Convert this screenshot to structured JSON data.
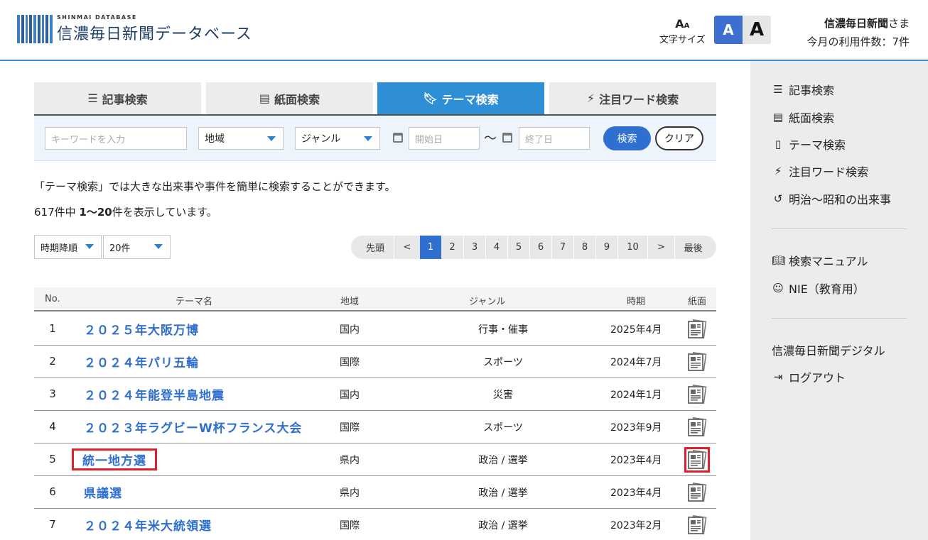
{
  "header": {
    "logo_sub": "SHINMAI DATABASE",
    "logo_title": "信濃毎日新聞データベース",
    "font_size_label": "文字サイズ",
    "font_size_icon": "font-size-icon",
    "font_small": "A",
    "font_large": "A",
    "user_name": "信濃毎日新聞",
    "user_suffix": "さま",
    "usage": "今月の利用件数：7件"
  },
  "tabs": [
    {
      "label": "記事検索",
      "icon": "list-icon"
    },
    {
      "label": "紙面検索",
      "icon": "newspaper-icon"
    },
    {
      "label": "テーマ検索",
      "icon": "bookmark-icon",
      "active": true
    },
    {
      "label": "注目ワード検索",
      "icon": "lightning-icon"
    }
  ],
  "search": {
    "keyword_placeholder": "キーワードを入力",
    "region_value": "地域",
    "genre_value": "ジャンル",
    "start_placeholder": "開始日",
    "tilde": "〜",
    "end_placeholder": "終了日",
    "search_label": "検索",
    "clear_label": "クリア"
  },
  "description": "「テーマ検索」では大きな出来事や事件を簡単に検索することができます。",
  "result": {
    "total": "617件中 ",
    "range": "1〜20",
    "suffix": "件を表示しています。"
  },
  "sort": {
    "order_value": "時期降順",
    "per_page_value": "20件"
  },
  "pager": {
    "first": "先頭",
    "prev": "<",
    "pages": [
      "1",
      "2",
      "3",
      "4",
      "5",
      "6",
      "7",
      "8",
      "9",
      "10"
    ],
    "current": "1",
    "next": ">",
    "last": "最後"
  },
  "table": {
    "headers": [
      "No.",
      "テーマ名",
      "地域",
      "ジャンル",
      "時期",
      "紙面"
    ],
    "rows": [
      {
        "no": "1",
        "name": "２０２５年大阪万博",
        "region": "国内",
        "genre": "行事・催事",
        "period": "2025年4月"
      },
      {
        "no": "2",
        "name": "２０２４年パリ五輪",
        "region": "国際",
        "genre": "スポーツ",
        "period": "2024年7月"
      },
      {
        "no": "3",
        "name": "２０２４年能登半島地震",
        "region": "国内",
        "genre": "災害",
        "period": "2024年1月"
      },
      {
        "no": "4",
        "name": "２０２３年ラグビーW杯フランス大会",
        "region": "国際",
        "genre": "スポーツ",
        "period": "2023年9月"
      },
      {
        "no": "5",
        "name": "統一地方選",
        "region": "県内",
        "genre": "政治 / 選挙",
        "period": "2023年4月",
        "highlighted": true
      },
      {
        "no": "6",
        "name": "県議選",
        "region": "県内",
        "genre": "政治 / 選挙",
        "period": "2023年4月"
      },
      {
        "no": "7",
        "name": "２０２４年米大統領選",
        "region": "国際",
        "genre": "政治 / 選挙",
        "period": "2023年2月"
      }
    ]
  },
  "sidebar": {
    "items": [
      {
        "label": "記事検索",
        "icon": "list-icon"
      },
      {
        "label": "紙面検索",
        "icon": "newspaper-icon"
      },
      {
        "label": "テーマ検索",
        "icon": "bookmark-icon"
      },
      {
        "label": "注目ワード検索",
        "icon": "lightning-icon"
      },
      {
        "label": "明治〜昭和の出来事",
        "icon": "history-icon"
      },
      {
        "label": "検索マニュアル",
        "icon": "book-icon"
      },
      {
        "label": "NIE（教育用）",
        "icon": "face-icon"
      },
      {
        "label": "信濃毎日新聞デジタル"
      },
      {
        "label": "ログアウト",
        "icon": "logout-icon"
      }
    ]
  }
}
